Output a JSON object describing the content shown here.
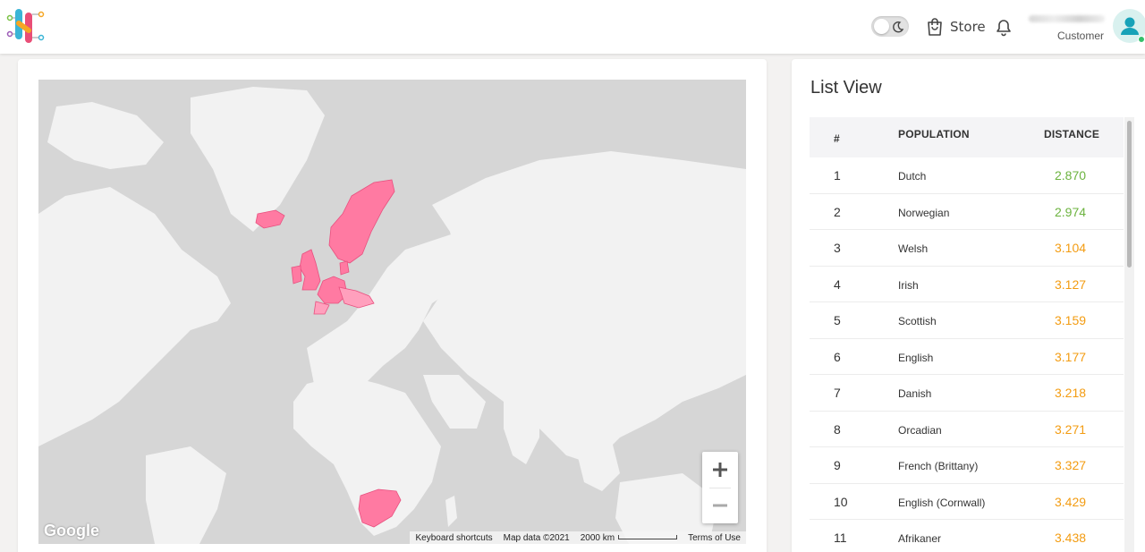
{
  "header": {
    "store_label": "Store",
    "role_label": "Customer",
    "icons": [
      "app-logo-icon",
      "moon-icon",
      "shopping-bag-icon",
      "bell-icon",
      "user-icon"
    ]
  },
  "map": {
    "attribution": {
      "shortcuts": "Keyboard shortcuts",
      "map_data": "Map data ©2021",
      "scale": "2000 km",
      "terms": "Terms of Use"
    },
    "google_label": "Google",
    "zoom_in_label": "+",
    "zoom_out_label": "−",
    "highlight_color": "#ff7aa2"
  },
  "list": {
    "title": "List View",
    "columns": [
      "#",
      "POPULATION",
      "DISTANCE"
    ],
    "rows": [
      {
        "idx": "1",
        "population": "Dutch",
        "distance": "2.870",
        "color": "#6cb33f"
      },
      {
        "idx": "2",
        "population": "Norwegian",
        "distance": "2.974",
        "color": "#6cb33f"
      },
      {
        "idx": "3",
        "population": "Welsh",
        "distance": "3.104",
        "color": "#f39c12"
      },
      {
        "idx": "4",
        "population": "Irish",
        "distance": "3.127",
        "color": "#f39c12"
      },
      {
        "idx": "5",
        "population": "Scottish",
        "distance": "3.159",
        "color": "#f39c12"
      },
      {
        "idx": "6",
        "population": "English",
        "distance": "3.177",
        "color": "#f39c12"
      },
      {
        "idx": "7",
        "population": "Danish",
        "distance": "3.218",
        "color": "#f39c12"
      },
      {
        "idx": "8",
        "population": "Orcadian",
        "distance": "3.271",
        "color": "#f39c12"
      },
      {
        "idx": "9",
        "population": "French (Brittany)",
        "distance": "3.327",
        "color": "#f39c12"
      },
      {
        "idx": "10",
        "population": "English (Cornwall)",
        "distance": "3.429",
        "color": "#f39c12"
      },
      {
        "idx": "11",
        "population": "Afrikaner",
        "distance": "3.438",
        "color": "#f39c12"
      }
    ]
  }
}
